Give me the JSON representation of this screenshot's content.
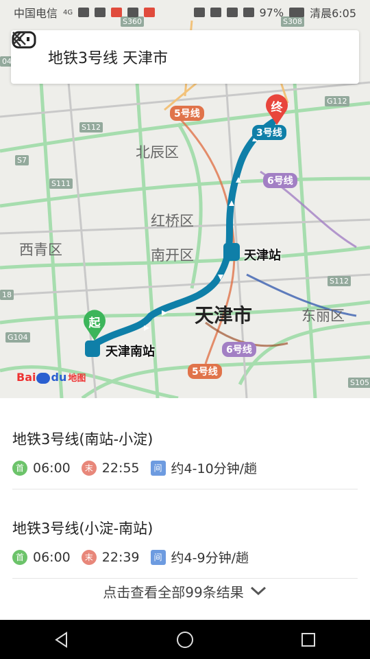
{
  "status": {
    "carrier": "中国电信",
    "network": "4G",
    "battery": "97%",
    "time": "清晨6:05"
  },
  "search": {
    "query": "地铁3号线 天津市"
  },
  "map": {
    "labels": {
      "beichen": "北辰区",
      "hongqiao": "红桥区",
      "nankai": "南开区",
      "xiqing": "西青区",
      "dongli": "东丽区",
      "tianjin_city": "天津市"
    },
    "badges": {
      "line5_top": "5号线",
      "line3": "3号线",
      "line6_right": "6号线",
      "line6_bottom": "6号线",
      "line5_bottom": "5号线"
    },
    "roads": {
      "s360": "S360",
      "s308": "S308",
      "g112": "G112",
      "s112_left": "S112",
      "s7": "S7",
      "s111": "S111",
      "s112_right": "S112",
      "g104": "G104",
      "s105": "S105",
      "left_edge_top": "04",
      "left_edge_bottom": "18"
    },
    "end_marker": "终",
    "start_marker": "起",
    "stations": {
      "tianjin_station": "天津站",
      "tianjin_south": "天津南站"
    },
    "logo": {
      "bai": "Bai",
      "du": "du",
      "ditu": "地图"
    },
    "colors": {
      "metro_line3": "#0f7fa8",
      "end_marker": "#e8453c",
      "start_marker": "#3cb55a"
    }
  },
  "routes": [
    {
      "title": "地铁3号线(南站-小淀)",
      "first_label": "首",
      "first_time": "06:00",
      "last_label": "末",
      "last_time": "22:55",
      "interval_label": "间",
      "interval": "约4-10分钟/趟"
    },
    {
      "title": "地铁3号线(小淀-南站)",
      "first_label": "首",
      "first_time": "06:00",
      "last_label": "末",
      "last_time": "22:39",
      "interval_label": "间",
      "interval": "约4-9分钟/趟"
    }
  ],
  "more_results": "点击查看全部99条结果"
}
